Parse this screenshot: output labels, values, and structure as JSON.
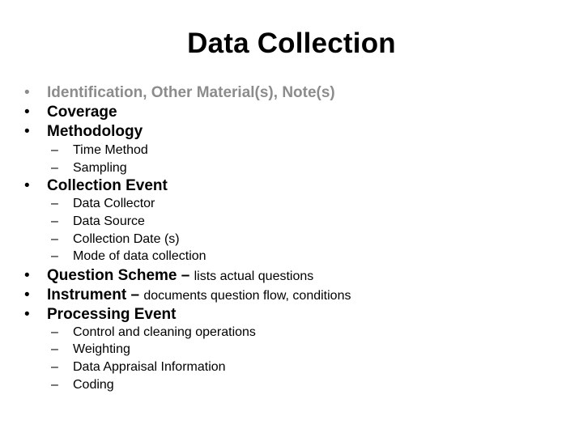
{
  "slide": {
    "title": "Data Collection",
    "bullet_glyph": "•",
    "dash_glyph": "–",
    "items": [
      {
        "label": "Identification, Other Material(s), Note(s)",
        "dimmed": true
      },
      {
        "label": "Coverage"
      },
      {
        "label": "Methodology",
        "subitems": [
          "Time Method",
          "Sampling"
        ]
      },
      {
        "label": "Collection Event",
        "subitems": [
          "Data Collector",
          "Data Source",
          "Collection Date (s)",
          "Mode of data collection"
        ]
      },
      {
        "label": "Question Scheme",
        "separator": " – ",
        "description": "lists actual questions"
      },
      {
        "label": "Instrument",
        "separator": " – ",
        "description": "documents question flow, conditions"
      },
      {
        "label": "Processing Event",
        "subitems": [
          "Control and cleaning operations",
          "Weighting",
          "Data Appraisal Information",
          "Coding"
        ]
      }
    ]
  },
  "colors": {
    "dimmed_text": "#8c8c8c",
    "text": "#000000",
    "background": "#ffffff"
  }
}
